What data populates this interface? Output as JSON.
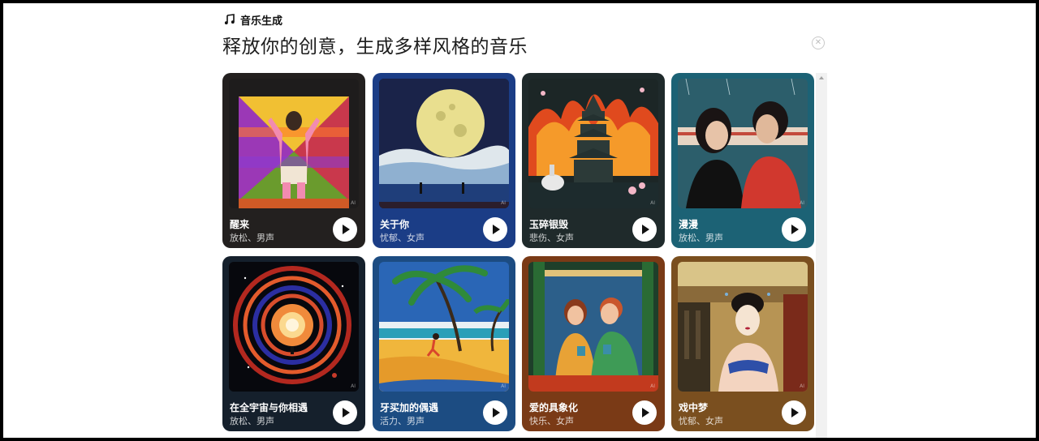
{
  "header": {
    "label": "音乐生成",
    "title": "释放你的创意，生成多样风格的音乐",
    "icon": "music-note-icon"
  },
  "colors": {
    "card1": "#23201f",
    "card2": "#1b3d86",
    "card3": "#1f2a2b",
    "card4": "#1c6275",
    "card5": "#15202c",
    "card6": "#1c4c82",
    "card7": "#7a3a16",
    "card8": "#7a4f1f"
  },
  "cards": [
    {
      "title": "醒来",
      "tags": "放松、男声"
    },
    {
      "title": "关于你",
      "tags": "忧郁、女声"
    },
    {
      "title": "玉碎银毁",
      "tags": "悲伤、女声"
    },
    {
      "title": "漫漫",
      "tags": "放松、男声"
    },
    {
      "title": "在全宇宙与你相遇",
      "tags": "放松、男声"
    },
    {
      "title": "牙买加的偶遇",
      "tags": "活力、男声"
    },
    {
      "title": "爱的具象化",
      "tags": "快乐、女声"
    },
    {
      "title": "戏中梦",
      "tags": "忧郁、女声"
    }
  ]
}
